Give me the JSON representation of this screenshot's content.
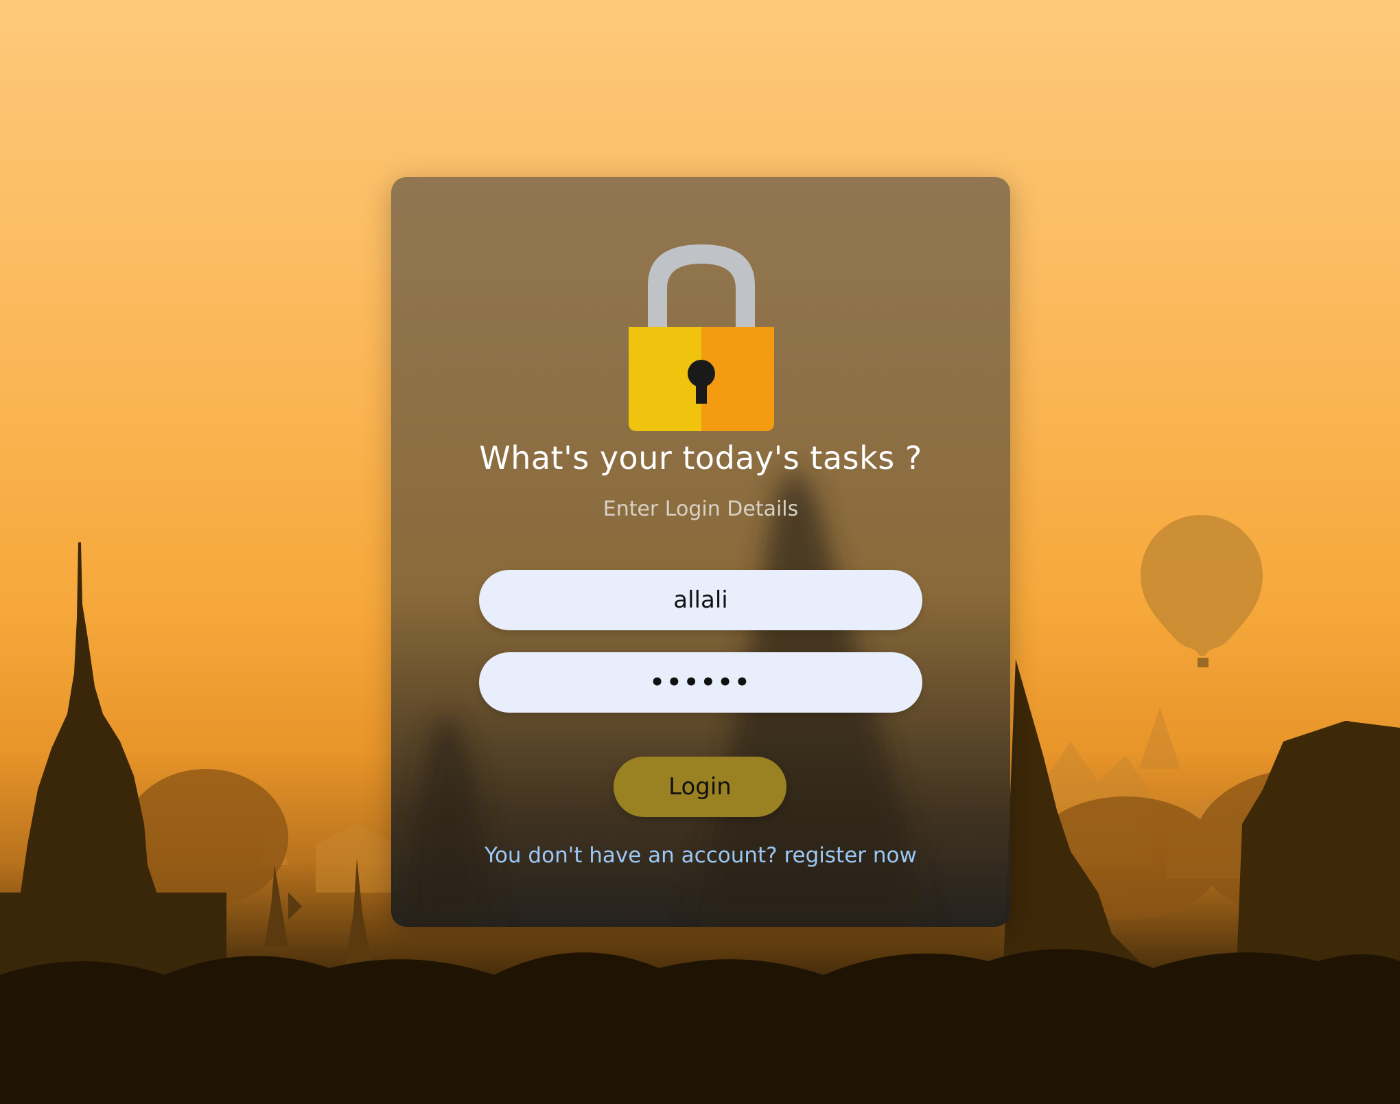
{
  "login": {
    "title": "What's your today's tasks ?",
    "subtitle": "Enter Login Details",
    "username_value": "allali",
    "password_value": "••••••",
    "login_label": "Login",
    "register_text": "You don't have an account? register now"
  },
  "icons": {
    "lock": "lock-icon"
  },
  "colors": {
    "field_bg": "#e8eefb",
    "button_bg": "#9a8122",
    "link": "#9cc8f5",
    "lock_left": "#f0c30f",
    "lock_right": "#f39c12",
    "shackle": "#bfc3c7"
  }
}
